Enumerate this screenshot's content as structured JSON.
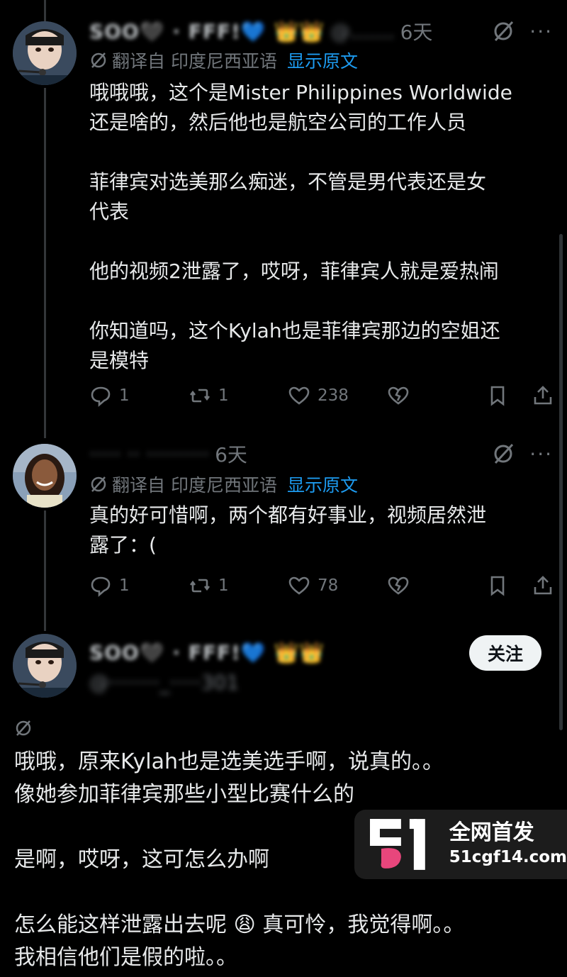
{
  "posts": [
    {
      "author_display": "SOO🖤 · FFF!💙 👑👑",
      "handle_blur": "@.......",
      "time": "6天",
      "translate_label": "翻译自 印度尼西亚语",
      "show_original": "显示原文",
      "text": "哦哦哦，这个是Mister Philippines Worldwide\n还是啥的，然后他也是航空公司的工作人员\n\n菲律宾对选美那么痴迷，不管是男代表还是女\n代表\n\n他的视频2泄露了，哎呀，菲律宾人就是爱热闹\n\n你知道吗，这个Kylah也是菲律宾那边的空姐还\n是模特",
      "replies": "1",
      "reposts": "1",
      "likes": "238"
    },
    {
      "author_display": "····· ·· ··········",
      "time": "6天",
      "translate_label": "翻译自 印度尼西亚语",
      "show_original": "显示原文",
      "text": "真的好可惜啊，两个都有好事业，视频居然泄\n露了：(",
      "replies": "1",
      "reposts": "1",
      "likes": "78"
    }
  ],
  "main_post": {
    "author_display": "SOO🖤 · FFF!💙 👑👑",
    "handle_blur": "@········_·····301",
    "follow_label": "关注",
    "text": "哦哦，原来Kylah也是选美选手啊，说真的。。\n像她参加菲律宾那些小型比赛什么的\n\n是啊，哎呀，这可怎么办啊\n\n怎么能这样泄露出去呢 😩 真可怜，我觉得啊。。\n我相信他们是假的啦。。"
  },
  "watermark": {
    "line1": "全网首发",
    "line2": "51cgf14.com"
  },
  "colors": {
    "background": "#000000",
    "text": "#e7e9ea",
    "muted": "#71767b",
    "link": "#1d9bf0",
    "follow_bg": "#eff3f4",
    "watermark_pink": "#e8467c"
  }
}
